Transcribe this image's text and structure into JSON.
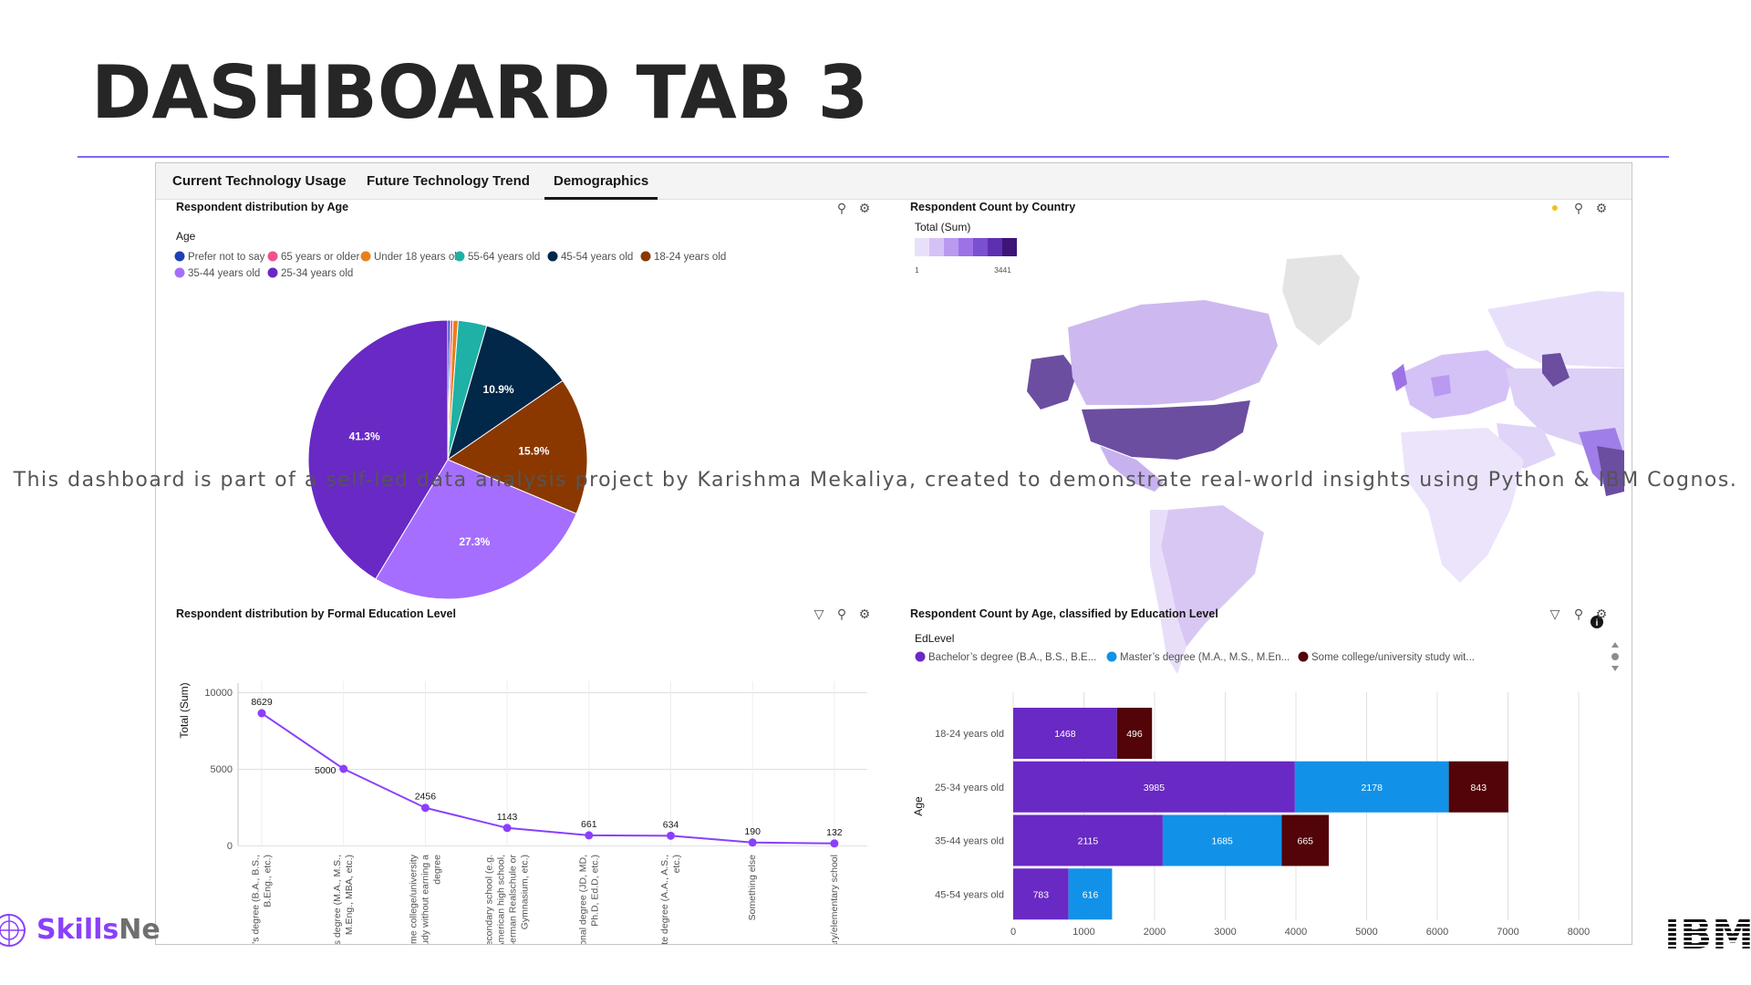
{
  "slide": {
    "title": "DASHBOARD TAB 3",
    "watermark": "This dashboard is part of a self-led data analysis project by Karishma Mekaliya, created to demonstrate real-world insights using Python & IBM Cognos.",
    "footer_brand_part1": "Skills",
    "footer_brand_part2": "Ne",
    "ibm_logo_text": "IBM"
  },
  "tabs": [
    {
      "label": "Current Technology Usage",
      "active": false
    },
    {
      "label": "Future Technology Trend",
      "active": false
    },
    {
      "label": "Demographics",
      "active": true
    }
  ],
  "widgets": {
    "age_pie": {
      "title": "Respondent distribution by Age",
      "legend_title": "Age"
    },
    "country_map": {
      "title": "Respondent Count by Country",
      "legend_title": "Total (Sum)",
      "scale_min": "1",
      "scale_max": "3441",
      "colors": [
        "#e8e0fb",
        "#d4c2f7",
        "#b99af0",
        "#9d72e6",
        "#7b4fd1",
        "#5e2fb0",
        "#3d1478"
      ]
    },
    "education_line": {
      "title": "Respondent distribution by Formal Education Level",
      "ylabel": "Total (Sum)"
    },
    "age_edu_bar": {
      "title": "Respondent Count by Age, classified by Education Level",
      "legend_title": "EdLevel",
      "ylabel": "Age",
      "legend": [
        {
          "name": "Bachelor’s degree (B.A., B.S., B.E...",
          "color": "#6929c4"
        },
        {
          "name": "Master’s degree (M.A., M.S., M.En...",
          "color": "#1192e8"
        },
        {
          "name": "Some college/university study wit...",
          "color": "#520408"
        }
      ]
    }
  },
  "chart_data": [
    {
      "type": "pie",
      "title": "Respondent distribution by Age",
      "legend_title": "Age",
      "slices": [
        {
          "name": "Prefer not to say",
          "value": 0.3,
          "color": "#1f3eb8"
        },
        {
          "name": "65 years or older",
          "value": 0.3,
          "color": "#ee538b"
        },
        {
          "name": "Under 18 years old",
          "value": 0.6,
          "color": "#e8801a"
        },
        {
          "name": "55-64 years old",
          "value": 3.3,
          "color": "#1fb0a6"
        },
        {
          "name": "45-54 years old",
          "value": 10.9,
          "color": "#012749",
          "label": "10.9%"
        },
        {
          "name": "18-24 years old",
          "value": 15.9,
          "color": "#8a3800",
          "label": "15.9%"
        },
        {
          "name": "35-44 years old",
          "value": 27.3,
          "color": "#a56eff",
          "label": "27.3%"
        },
        {
          "name": "25-34 years old",
          "value": 41.3,
          "color": "#6929c4",
          "label": "41.3%"
        }
      ]
    },
    {
      "type": "line",
      "title": "Respondent distribution by Formal Education Level",
      "ylabel": "Total (Sum)",
      "ylim": [
        0,
        10000
      ],
      "yticks": [
        "0",
        "5000",
        "10000"
      ],
      "color": "#8a3ffc",
      "points": [
        {
          "category": "Bachelor’s degree (B.A., B.S., B.Eng., etc.)",
          "tick_lines": [
            "chelor's degree (B.A., B.S.,",
            "B.Eng., etc.)"
          ],
          "value": 8629
        },
        {
          "category": "Master’s degree (M.A., M.S., M.Eng., MBA, etc.)",
          "tick_lines": [
            "aster's degree (M.A., M.S.,",
            "M.Eng., MBA, etc.)"
          ],
          "value": 5000
        },
        {
          "category": "Some college/university study without earning a degree",
          "tick_lines": [
            "Some college/university",
            "study without earning a",
            "degree"
          ],
          "value": 2456
        },
        {
          "category": "Secondary school (e.g. American high school, German Realschule or Gymnasium, etc.)",
          "tick_lines": [
            "Secondary school (e.g.",
            "American high school,",
            "German Realschule or",
            "Gymnasium, etc.)"
          ],
          "value": 1143
        },
        {
          "category": "Professional degree (JD, MD, Ph.D, Ed.D, etc.)",
          "tick_lines": [
            "ofessional degree (JD, MD,",
            "Ph.D, Ed.D, etc.)"
          ],
          "value": 661
        },
        {
          "category": "Associate degree (A.A., A.S., etc.)",
          "tick_lines": [
            "ssociate degree (A.A., A.S.,",
            "etc.)"
          ],
          "value": 634
        },
        {
          "category": "Something else",
          "tick_lines": [
            "Something else"
          ],
          "value": 190
        },
        {
          "category": "Primary/elementary school",
          "tick_lines": [
            "rimary/elementary school"
          ],
          "value": 132
        }
      ]
    },
    {
      "type": "bar",
      "orientation": "horizontal",
      "stacked": true,
      "title": "Respondent Count by Age, classified by Education Level",
      "ylabel": "Age",
      "legend_title": "EdLevel",
      "xlim": [
        0,
        8000
      ],
      "xticks": [
        "0",
        "1000",
        "2000",
        "3000",
        "4000",
        "5000",
        "6000",
        "7000",
        "8000"
      ],
      "categories": [
        "18-24 years old",
        "25-34 years old",
        "35-44 years old",
        "45-54 years old"
      ],
      "series": [
        {
          "name": "Bachelor’s degree (B.A., B.S., B.E...",
          "color": "#6929c4",
          "values": [
            1468,
            3985,
            2115,
            783
          ]
        },
        {
          "name": "Master’s degree (M.A., M.S., M.En...",
          "color": "#1192e8",
          "values": [
            null,
            2178,
            1685,
            616
          ]
        },
        {
          "name": "Some college/university study wit...",
          "color": "#520408",
          "values": [
            496,
            843,
            665,
            null
          ]
        }
      ]
    }
  ]
}
